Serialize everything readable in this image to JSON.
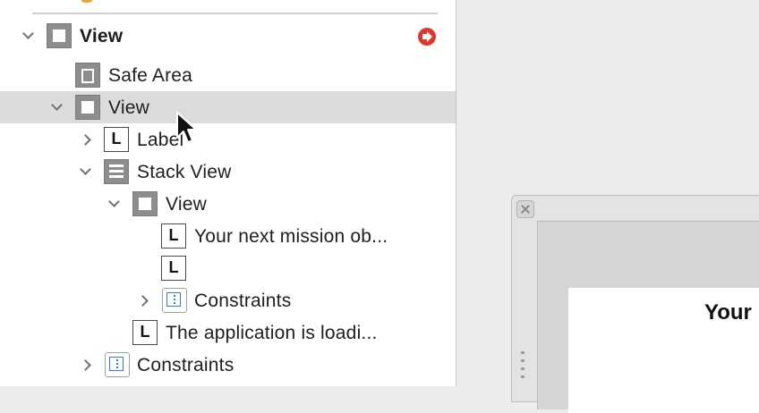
{
  "outline": {
    "rows": [
      {
        "label": "View",
        "icon": "view-icon",
        "expanded": true,
        "bold": true
      },
      {
        "label": "Safe Area",
        "icon": "safe-area-icon"
      },
      {
        "label": "View",
        "icon": "view-icon",
        "expanded": true,
        "selected": true
      },
      {
        "label": "Label",
        "icon": "label-icon",
        "expanded": false
      },
      {
        "label": "Stack View",
        "icon": "stack-view-icon",
        "expanded": true
      },
      {
        "label": "View",
        "icon": "view-icon",
        "expanded": true
      },
      {
        "label": "Your next mission ob...",
        "icon": "label-icon"
      },
      {
        "label": "",
        "icon": "label-icon"
      },
      {
        "label": "Constraints",
        "icon": "constraints-icon",
        "expanded": false
      },
      {
        "label": "The application is loadi...",
        "icon": "label-icon"
      },
      {
        "label": "Constraints",
        "icon": "constraints-icon",
        "expanded": false
      }
    ]
  },
  "canvas": {
    "preview_text": "Your"
  },
  "colors": {
    "selection": "#dcdcdc",
    "warning": "#e2362c",
    "constraint_blue": "#2f7fd6"
  }
}
